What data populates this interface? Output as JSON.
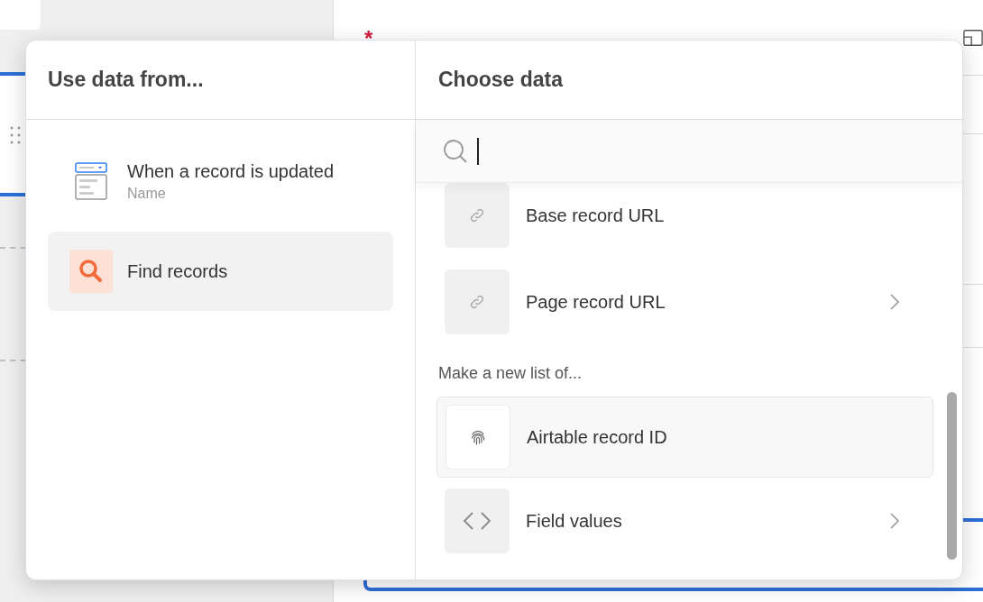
{
  "background": {
    "required_mark": "*"
  },
  "popup": {
    "source_panel": {
      "title": "Use data from...",
      "items": [
        {
          "kind": "trigger",
          "label": "When a record is updated",
          "sublabel": "Name",
          "selected": false
        },
        {
          "kind": "find",
          "label": "Find records",
          "selected": true
        }
      ]
    },
    "data_panel": {
      "title": "Choose data",
      "sections": [
        {
          "items": [
            {
              "kind": "link",
              "label": "Base record URL",
              "has_submenu": false,
              "highlighted": false
            },
            {
              "kind": "link",
              "label": "Page record URL",
              "has_submenu": true,
              "highlighted": false
            }
          ]
        },
        {
          "heading": "Make a new list of...",
          "items": [
            {
              "kind": "fingerprint",
              "label": "Airtable record ID",
              "has_submenu": false,
              "highlighted": true
            },
            {
              "kind": "code",
              "label": "Field values",
              "has_submenu": true,
              "highlighted": false
            }
          ]
        }
      ]
    }
  }
}
